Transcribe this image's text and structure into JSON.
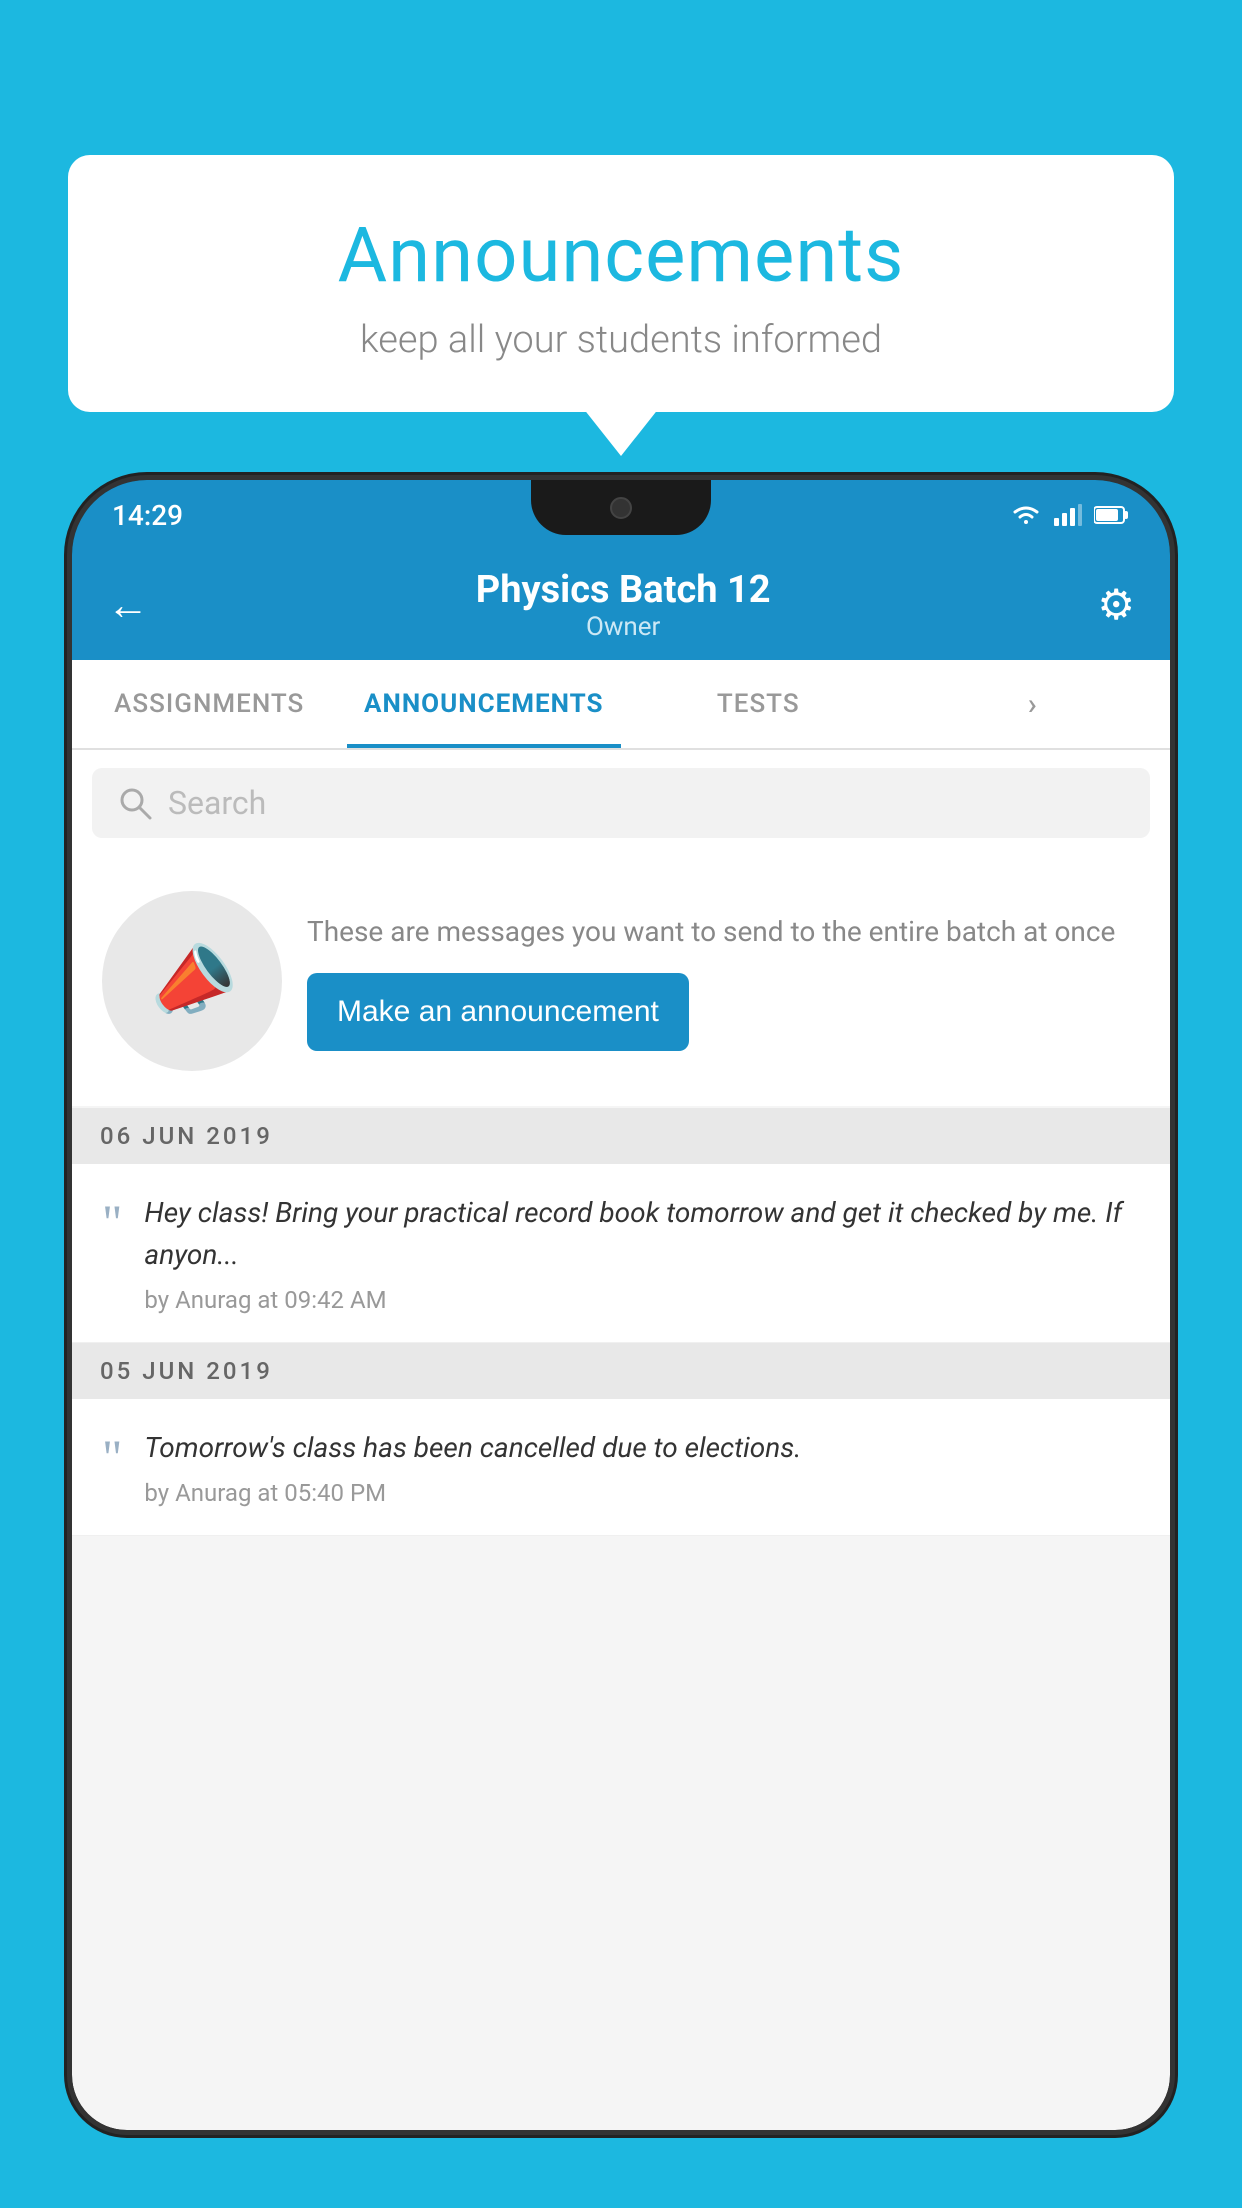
{
  "background_color": "#1cb8e0",
  "bubble": {
    "title": "Announcements",
    "subtitle": "keep all your students informed"
  },
  "phone": {
    "status_bar": {
      "time": "14:29"
    },
    "header": {
      "title": "Physics Batch 12",
      "subtitle": "Owner",
      "back_label": "←",
      "gear_label": "⚙"
    },
    "tabs": [
      {
        "label": "ASSIGNMENTS",
        "active": false
      },
      {
        "label": "ANNOUNCEMENTS",
        "active": true
      },
      {
        "label": "TESTS",
        "active": false
      },
      {
        "label": "▸",
        "active": false
      }
    ],
    "search": {
      "placeholder": "Search"
    },
    "promo": {
      "description": "These are messages you want to send to the entire batch at once",
      "button_label": "Make an announcement"
    },
    "announcements": [
      {
        "date": "06  JUN  2019",
        "message": "Hey class! Bring your practical record book tomorrow and get it checked by me. If anyon...",
        "meta": "by Anurag at 09:42 AM"
      },
      {
        "date": "05  JUN  2019",
        "message": "Tomorrow's class has been cancelled due to elections.",
        "meta": "by Anurag at 05:40 PM"
      }
    ]
  }
}
